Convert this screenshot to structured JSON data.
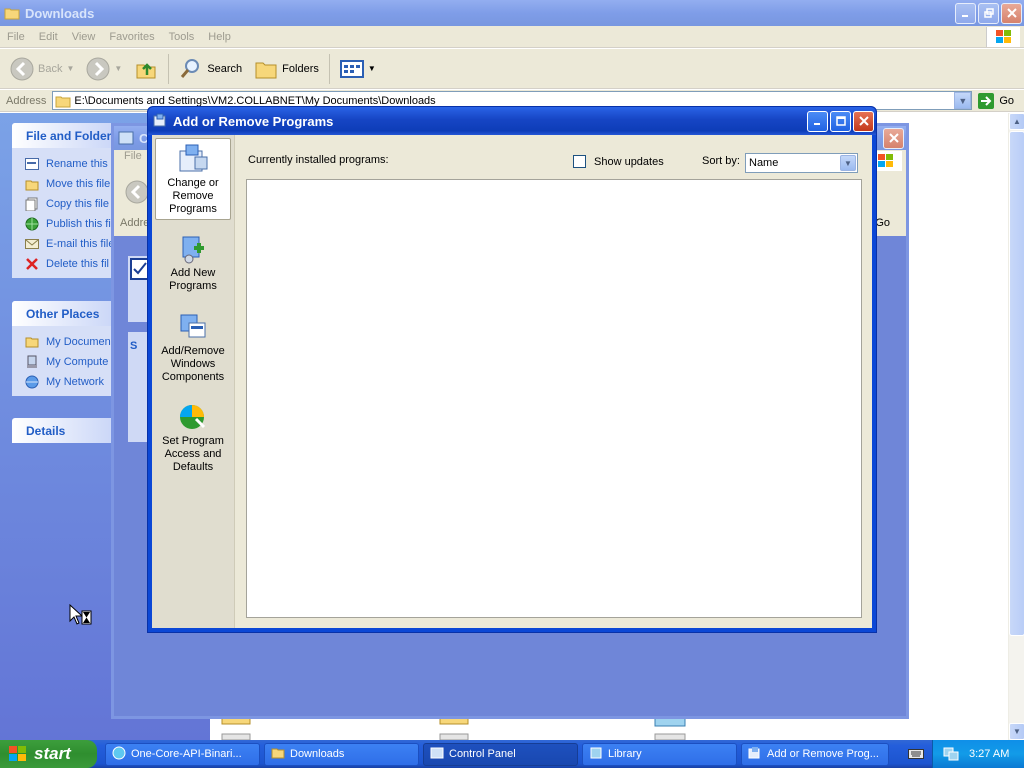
{
  "explorer": {
    "title": "Downloads",
    "menu": [
      "File",
      "Edit",
      "View",
      "Favorites",
      "Tools",
      "Help"
    ],
    "toolbar": {
      "back": "Back",
      "search": "Search",
      "folders": "Folders"
    },
    "address_label": "Address",
    "address_value": "E:\\Documents and Settings\\VM2.COLLABNET\\My Documents\\Downloads",
    "go_label": "Go",
    "file_tasks": {
      "heading": "File and Folder",
      "items": [
        "Rename this",
        "Move this file",
        "Copy this file",
        "Publish this fi",
        "E-mail this file",
        "Delete this fil"
      ]
    },
    "other_places": {
      "heading": "Other Places",
      "items": [
        "My Documen",
        "My Compute",
        "My Network"
      ]
    },
    "details_heading": "Details"
  },
  "control_panel": {
    "title": "C",
    "menu_file": "File",
    "address_label": "Addre",
    "pane_letter": "S",
    "go_label": "Go"
  },
  "arp": {
    "title": "Add or Remove Programs",
    "sidebar": [
      {
        "label": "Change or Remove Programs",
        "icon": "change-remove-programs-icon"
      },
      {
        "label": "Add New Programs",
        "icon": "add-new-programs-icon"
      },
      {
        "label": "Add/Remove Windows Components",
        "icon": "windows-components-icon"
      },
      {
        "label": "Set Program Access and Defaults",
        "icon": "program-access-icon"
      }
    ],
    "installed_label": "Currently installed programs:",
    "show_updates_label": "Show updates",
    "show_updates_checked": false,
    "sort_by_label": "Sort by:",
    "sort_by_value": "Name"
  },
  "taskbar": {
    "start_label": "start",
    "tasks": [
      {
        "label": "One-Core-API-Binari...",
        "icon": "browser-icon",
        "active": false
      },
      {
        "label": "Downloads",
        "icon": "folder-icon",
        "active": false
      },
      {
        "label": "Control Panel",
        "icon": "control-panel-icon",
        "active": true
      },
      {
        "label": "Library",
        "icon": "library-icon",
        "active": false
      },
      {
        "label": "Add or Remove Prog...",
        "icon": "add-remove-icon",
        "active": false
      }
    ],
    "clock": "3:27 AM"
  }
}
